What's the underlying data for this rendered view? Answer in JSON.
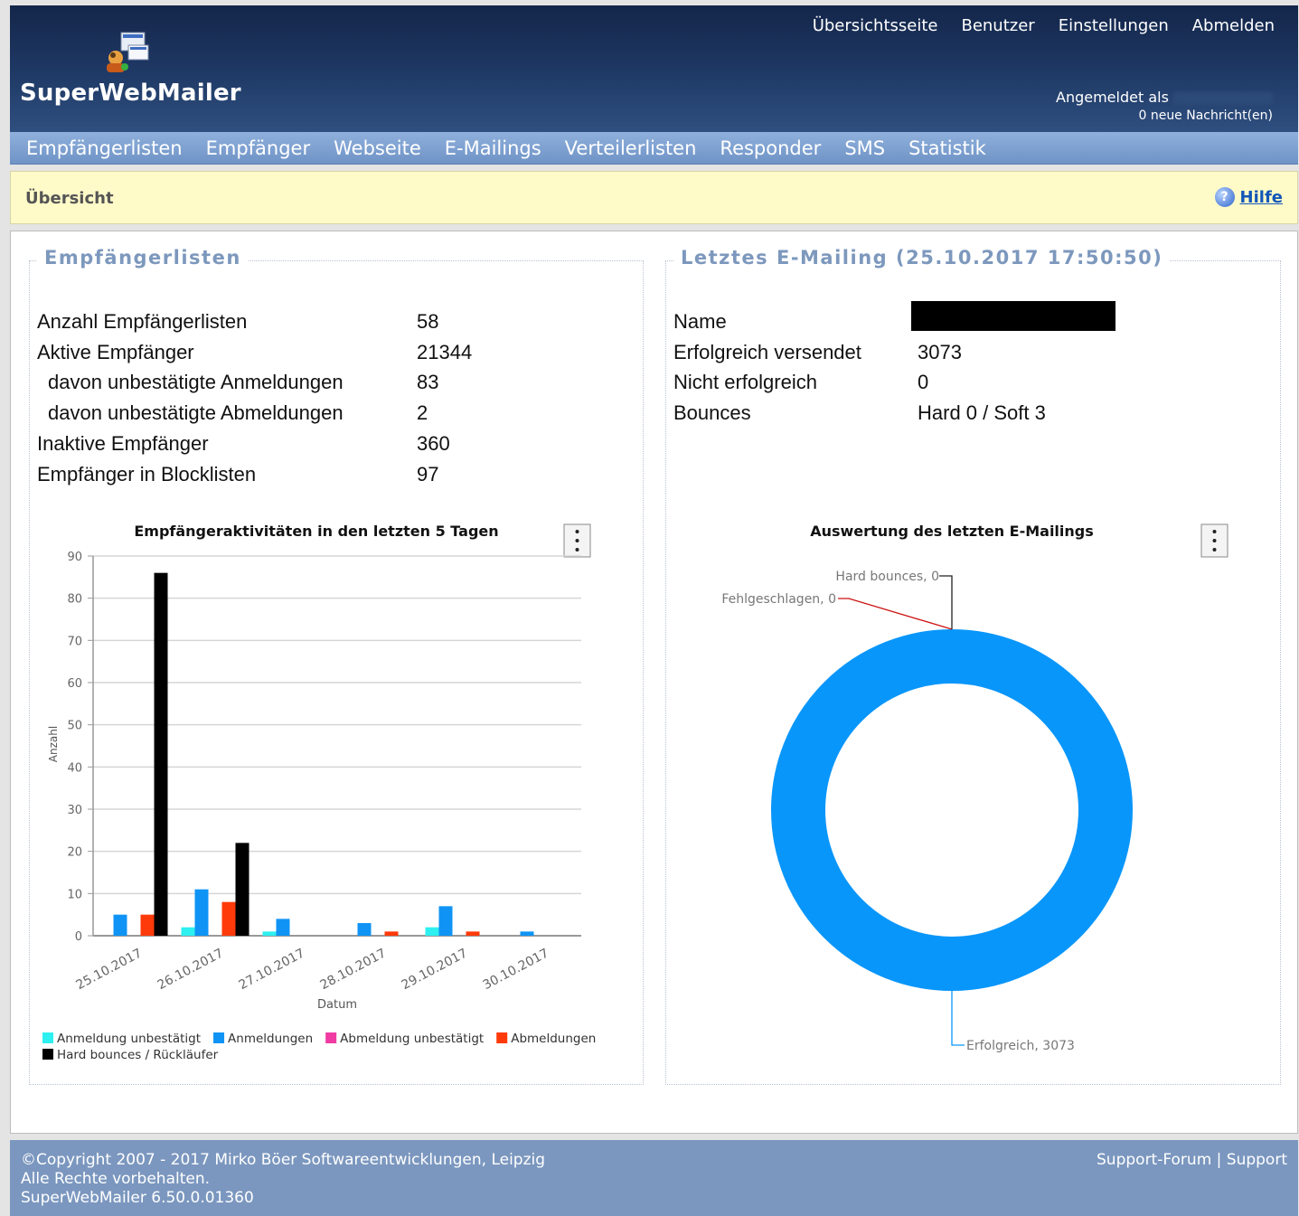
{
  "brand": {
    "name": "SuperWebMailer"
  },
  "top_nav": [
    "Übersichtsseite",
    "Benutzer",
    "Einstellungen",
    "Abmelden"
  ],
  "login": {
    "prefix": "Angemeldet als",
    "messages": "0 neue Nachricht(en)"
  },
  "main_nav": [
    "Empfängerlisten",
    "Empfänger",
    "Webseite",
    "E-Mailings",
    "Verteilerlisten",
    "Responder",
    "SMS",
    "Statistik"
  ],
  "breadcrumb": {
    "title": "Übersicht",
    "help": "Hilfe"
  },
  "left_panel": {
    "title": "Empfängerlisten",
    "rows": [
      {
        "label": "Anzahl Empfängerlisten",
        "value": "58"
      },
      {
        "label": "Aktive Empfänger",
        "value": "21344"
      },
      {
        "label": "davon unbestätigte Anmeldungen",
        "value": "83"
      },
      {
        "label": "davon unbestätigte Abmeldungen",
        "value": "2"
      },
      {
        "label": "Inaktive Empfänger",
        "value": "360"
      },
      {
        "label": "Empfänger in Blocklisten",
        "value": "97"
      }
    ]
  },
  "right_panel": {
    "title": "Letztes E-Mailing (25.10.2017 17:50:50)",
    "rows": [
      {
        "label": "Name",
        "value": ""
      },
      {
        "label": "Erfolgreich versendet",
        "value": "3073"
      },
      {
        "label": "Nicht erfolgreich",
        "value": "0"
      },
      {
        "label": "Bounces",
        "value": "Hard 0 / Soft 3"
      }
    ]
  },
  "chart_data": [
    {
      "type": "bar",
      "title": "Empfängeraktivitäten in den letzten 5 Tagen",
      "xlabel": "Datum",
      "ylabel": "Anzahl",
      "ylim": [
        0,
        90
      ],
      "yticks": [
        0,
        10,
        20,
        30,
        40,
        50,
        60,
        70,
        80,
        90
      ],
      "grid": true,
      "legend_position": "bottom",
      "categories": [
        "25.10.2017",
        "26.10.2017",
        "27.10.2017",
        "28.10.2017",
        "29.10.2017",
        "30.10.2017"
      ],
      "series": [
        {
          "name": "Anmeldung unbestätigt",
          "color": "#2ef0f0",
          "values": [
            0,
            2,
            1,
            0,
            2,
            0
          ]
        },
        {
          "name": "Anmeldungen",
          "color": "#0f94f5",
          "values": [
            5,
            11,
            4,
            3,
            7,
            1
          ]
        },
        {
          "name": "Abmeldung unbestätigt",
          "color": "#f03ba3",
          "values": [
            0,
            0,
            0,
            0,
            0,
            0
          ]
        },
        {
          "name": "Abmeldungen",
          "color": "#ff3a0a",
          "values": [
            5,
            8,
            0,
            1,
            1,
            0
          ]
        },
        {
          "name": "Hard bounces / Rückläufer",
          "color": "#000000",
          "values": [
            86,
            22,
            0,
            0,
            0,
            0
          ]
        }
      ]
    },
    {
      "type": "pie",
      "title": "Auswertung des letzten E-Mailings",
      "slices": [
        {
          "label": "Erfolgreich",
          "value": 3073,
          "color": "#0996fa"
        },
        {
          "label": "Fehlgeschlagen",
          "value": 0,
          "color": "#cc1111"
        },
        {
          "label": "Hard bounces",
          "value": 0,
          "color": "#222222"
        }
      ]
    }
  ],
  "footer": {
    "copyright": "©Copyright 2007 - 2017 Mirko Böer Softwareentwicklungen, Leipzig",
    "rights": "Alle Rechte vorbehalten.",
    "version": "SuperWebMailer 6.50.0.01360",
    "links": "Support-Forum | Support"
  }
}
